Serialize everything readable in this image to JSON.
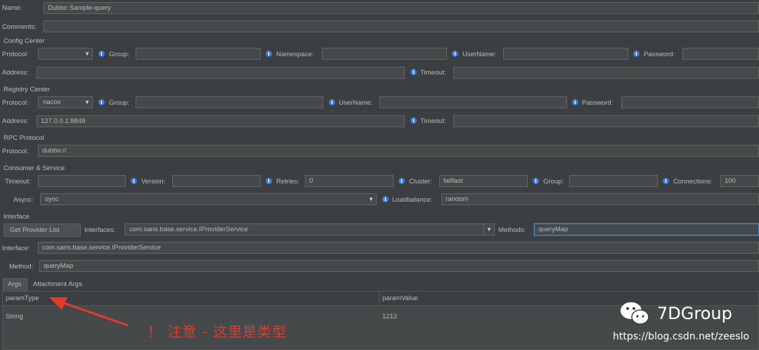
{
  "name": {
    "label": "Name:",
    "value": "Dubbo Sample-query"
  },
  "comments": {
    "label": "Comments:",
    "value": ""
  },
  "config_center": {
    "title": "Config Center",
    "protocol_label": "Protocol:",
    "protocol_value": "",
    "group_label": "Group:",
    "namespace_label": "Namespace:",
    "username_label": "UserName:",
    "password_label": "Password:",
    "address_label": "Address:",
    "address_value": "",
    "timeout_label": "Timeout:"
  },
  "registry_center": {
    "title": "Registry Center",
    "protocol_label": "Protocol:",
    "protocol_value": "nacos",
    "group_label": "Group:",
    "username_label": "UserName:",
    "password_label": "Password:",
    "address_label": "Address:",
    "address_value": "127.0.0.1:8848",
    "timeout_label": "Timeout:"
  },
  "rpc_protocol": {
    "title": "RPC Protocol",
    "protocol_label": "Protocol:",
    "protocol_value": "dubbo://"
  },
  "consumer_service": {
    "title": "Consumer & Service",
    "timeout_label": "Timeout:",
    "version_label": "Version:",
    "retries_label": "Retries:",
    "retries_value": "0",
    "cluster_label": "Cluster:",
    "cluster_value": "failfast",
    "group_label": "Group:",
    "connections_label": "Connections:",
    "connections_value": "100",
    "async_label": "Async:",
    "async_value": "sync",
    "loadbalance_label": "Loadbalance:",
    "loadbalance_value": "random"
  },
  "interface_section": {
    "title": "Interface",
    "get_provider_button": "Get Provider List",
    "interfaces_label": "Interfaces:",
    "interfaces_value": "com.sans.base.service.IProviderService",
    "methods_label": "Methods:",
    "methods_value": "queryMap",
    "interface_label": "Interface:",
    "interface_value": "com.sans.base.service.IProviderService",
    "method_label": "Method:",
    "method_value": "queryMap"
  },
  "tabs": {
    "args": "Args",
    "attachment_args": "Attachment Args"
  },
  "args_table": {
    "headers": [
      "paramType",
      "paramValue"
    ],
    "rows": [
      [
        "String",
        "1212"
      ]
    ]
  },
  "annotation": {
    "text": "！ 注意 - 这里是类型"
  },
  "watermark": {
    "title": "7DGroup",
    "url": "https://blog.csdn.net/zeeslo"
  },
  "colors": {
    "background": "#3c3f41",
    "field": "#45494a",
    "info_icon": "#3b7bd6",
    "annotation_red": "#e33b2e",
    "focus_border": "#4a88c7"
  }
}
